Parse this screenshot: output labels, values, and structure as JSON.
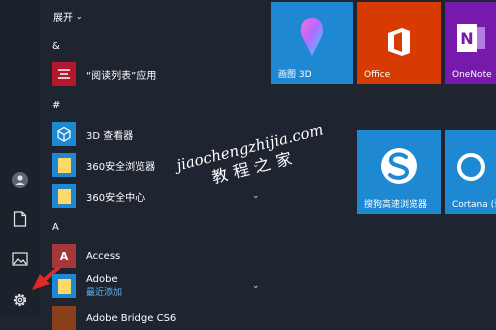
{
  "list": {
    "expand_label": "展开",
    "groups": {
      "amp": "&",
      "hash": "#",
      "a": "A"
    },
    "apps": {
      "reading_list": "“阅读列表”应用",
      "viewer3d": "3D 查看器",
      "browser360": "360安全浏览器",
      "center360": "360安全中心",
      "access": "Access",
      "adobe": "Adobe",
      "adobe_sub": "最近添加",
      "adobe_bridge": "Adobe Bridge CS6"
    }
  },
  "tiles": {
    "paint3d": "画图 3D",
    "office": "Office",
    "onenote": "OneNote",
    "sogou": "搜狗高速浏览器",
    "cortana": "Cortana (语"
  },
  "watermark": {
    "url": "jiaochengzhijia.com",
    "text": "教程之家"
  },
  "colors": {
    "background": "#1f2530",
    "tile_blue": "#1e88d2",
    "office_red": "#d83b01",
    "onenote_purple": "#7719aa",
    "reading_list_red": "#b4172e",
    "folder_yellow": "#ffd86a",
    "access_red": "#a4373a",
    "arrow_red": "#e02828"
  }
}
